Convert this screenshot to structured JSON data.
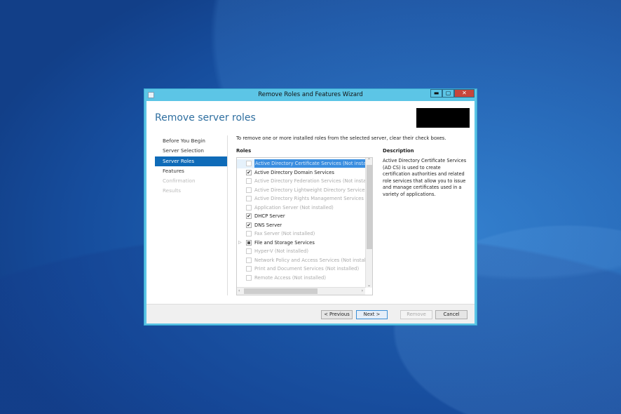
{
  "window": {
    "title": "Remove Roles and Features Wizard",
    "minimize": "▬",
    "maximize": "▢",
    "close": "✕"
  },
  "page_title": "Remove server roles",
  "nav": [
    "Before You Begin",
    "Server Selection",
    "Server Roles",
    "Features",
    "Confirmation",
    "Results"
  ],
  "intro": "To remove one or more installed roles from the selected server, clear their check boxes.",
  "roles_label": "Roles",
  "roles": [
    {
      "label": "Active Directory Certificate Services (Not installed)",
      "state": "unchecked",
      "installed": false
    },
    {
      "label": "Active Directory Domain Services",
      "state": "checked",
      "installed": true
    },
    {
      "label": "Active Directory Federation Services (Not installed)",
      "state": "unchecked",
      "installed": false
    },
    {
      "label": "Active Directory Lightweight Directory Services (Not installed)",
      "state": "unchecked",
      "installed": false
    },
    {
      "label": "Active Directory Rights Management Services (Not installed)",
      "state": "unchecked",
      "installed": false
    },
    {
      "label": "Application Server (Not installed)",
      "state": "unchecked",
      "installed": false
    },
    {
      "label": "DHCP Server",
      "state": "checked",
      "installed": true
    },
    {
      "label": "DNS Server",
      "state": "checked",
      "installed": true
    },
    {
      "label": "Fax Server (Not installed)",
      "state": "unchecked",
      "installed": false
    },
    {
      "label": "File and Storage Services",
      "state": "partial",
      "installed": true
    },
    {
      "label": "Hyper-V (Not installed)",
      "state": "unchecked",
      "installed": false
    },
    {
      "label": "Network Policy and Access Services (Not installed)",
      "state": "unchecked",
      "installed": false
    },
    {
      "label": "Print and Document Services (Not installed)",
      "state": "unchecked",
      "installed": false
    },
    {
      "label": "Remote Access (Not installed)",
      "state": "unchecked",
      "installed": false
    }
  ],
  "description_label": "Description",
  "description": "Active Directory Certificate Services (AD CS) is used to create certification authorities and related role services that allow you to issue and manage certificates used in a variety of applications.",
  "buttons": {
    "previous": "< Previous",
    "next": "Next >",
    "remove": "Remove",
    "cancel": "Cancel"
  }
}
